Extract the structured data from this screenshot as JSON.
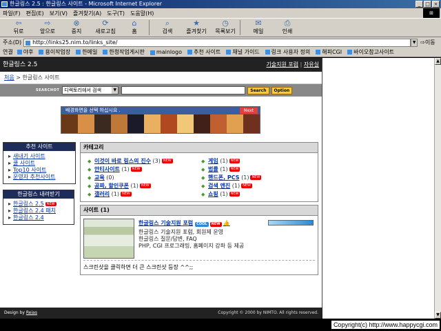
{
  "window": {
    "title": "한글링스 2.5 : 한글링스 사이트 - Microsoft Internet Explorer"
  },
  "menu": [
    "파일(F)",
    "편집(E)",
    "보기(V)",
    "즐겨찾기(A)",
    "도구(T)",
    "도움말(H)"
  ],
  "toolbar": {
    "back": "뒤로",
    "forward": "앞으로",
    "stop": "중지",
    "refresh": "새로고침",
    "home": "홈",
    "search": "검색",
    "favorites": "즐겨찾기",
    "history": "목록보기",
    "mail": "메일",
    "print": "인쇄"
  },
  "address": {
    "label": "주소(D)",
    "url": "http://links25.nim.to/links_site/",
    "go": "이동"
  },
  "links": {
    "label": "연결",
    "items": [
      "야후",
      "용이작업장",
      "한메일",
      "한청작업게시판",
      "mainlogo",
      "추천 사이트",
      "채널 가이드",
      "링크 사용자 정의",
      "해피CGI",
      "바이오참고사이트"
    ]
  },
  "site": {
    "name": "한글링스 2.5",
    "header_links": [
      "기술지원 포럼",
      "자유실"
    ],
    "breadcrumb": {
      "home": "처음",
      "sep": " > ",
      "current": "한글링스 사이트"
    },
    "search": {
      "label": "SEARCHOT",
      "select": "디렉토리에서 검색",
      "search_btn": "Search",
      "option_btn": "Option"
    },
    "banner": {
      "text": "배경화면을 선택 하십시요 .",
      "next": "Next"
    },
    "recommend": {
      "title": "추천 사이트",
      "items": [
        "새내기 사이트",
        "쿨 사이트",
        "Top10 사이트",
        "운영자 추천사이트"
      ]
    },
    "download": {
      "title": "한글링스 내려받기",
      "items": [
        "한글링스 2.5",
        "한글링스 2.4 패치",
        "한글링스 2.4"
      ],
      "new": "NEW"
    },
    "categories": {
      "title": "카테고리",
      "left": [
        {
          "name": "이것이 바로 링스의 진수",
          "count": "(3)",
          "new": "NEW"
        },
        {
          "name": "안티사이트",
          "count": "(1)",
          "new": "NEW"
        },
        {
          "name": "교육",
          "count": "(0)",
          "new": ""
        },
        {
          "name": "공짜, 할인쿠폰",
          "count": "(1)",
          "new": "NEW"
        },
        {
          "name": "갤러리",
          "count": "(1)",
          "new": "NEW"
        }
      ],
      "right": [
        {
          "name": "게임",
          "count": "(1)",
          "new": "NEW"
        },
        {
          "name": "법률",
          "count": "(1)",
          "new": "NEW"
        },
        {
          "name": "핸드폰, PCS",
          "count": "(1)",
          "new": "NEW"
        },
        {
          "name": "검색 엔진",
          "count": "(1)",
          "new": "NEW"
        },
        {
          "name": "쇼핑",
          "count": "(1)",
          "new": "NEW"
        }
      ]
    },
    "sites": {
      "title": "사이트 (1)",
      "item": {
        "title": "한글링스 기술지원 포럼",
        "cool": "COOL",
        "new": "NEW",
        "thumbs": "👍",
        "desc": [
          "한글링스 기술지원 포럼, 회원제 운영",
          "한글링스 질문/답변, FAQ",
          "PHP, CGI 프로그래밍, 홈페이지 강좌 등 제공"
        ]
      },
      "hint": "스크린샷을 클릭하면 더 큰 스크린샷 등장 ^^;;"
    },
    "footer": {
      "design_by": "Design by ",
      "designer": "Reias",
      "copyright": "Copyright © 2000 by NIMTO. All rights reserved."
    }
  },
  "watermark": "Copyright(c) http://www.happycgi.com",
  "colors": {
    "title_bar": "#0a246a",
    "site_header": "#222222",
    "left_box_header": "#1e2c5a",
    "new_badge": "#e00000",
    "link": "#0033aa"
  }
}
